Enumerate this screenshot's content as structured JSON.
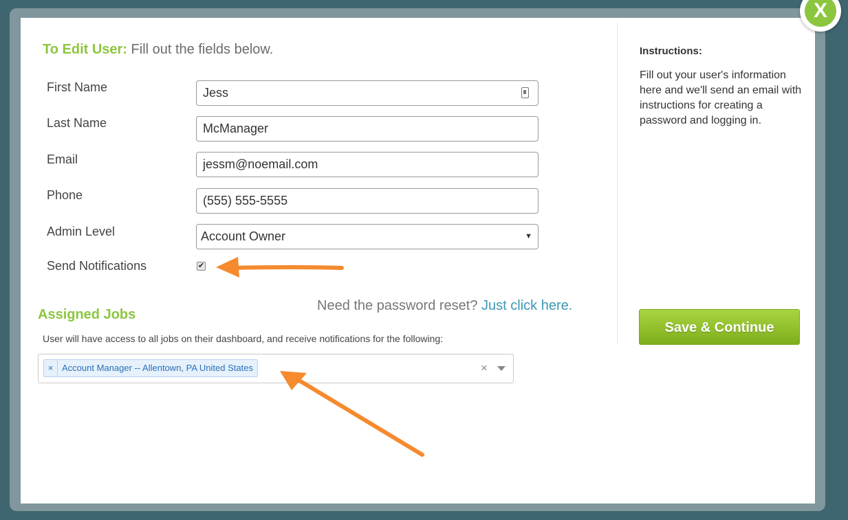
{
  "modal": {
    "close_label": "X",
    "heading_prefix": "To Edit User:",
    "heading_suffix": "Fill out the fields below."
  },
  "form": {
    "first_name": {
      "label": "First Name",
      "value": "Jess"
    },
    "last_name": {
      "label": "Last Name",
      "value": "McManager"
    },
    "email": {
      "label": "Email",
      "value": "jessm@noemail.com"
    },
    "phone": {
      "label": "Phone",
      "value": "(555) 555-5555"
    },
    "admin_level": {
      "label": "Admin Level",
      "value": "Account Owner"
    },
    "send_notifications": {
      "label": "Send Notifications",
      "checked": true
    }
  },
  "password_reset": {
    "prompt": "Need the password reset?",
    "link": "Just click here."
  },
  "jobs": {
    "title": "Assigned Jobs",
    "description": "User will have access to all jobs on their dashboard, and receive notifications for the following:",
    "tags": [
      "Account Manager -- Allentown, PA United States"
    ]
  },
  "instructions": {
    "title": "Instructions:",
    "body": "Fill out your user's information here and we'll send an email with instructions for creating a password and logging in."
  },
  "actions": {
    "save_label": "Save & Continue"
  },
  "colors": {
    "accent_green": "#8cc63f",
    "link_blue": "#3b97b5",
    "annotation_orange": "#f58a2e"
  }
}
